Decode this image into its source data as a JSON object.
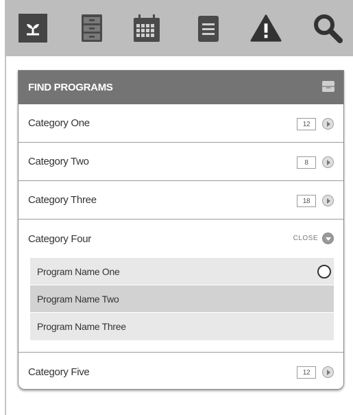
{
  "toolbar": {
    "icons": [
      "home-plant-icon",
      "file-cabinet-icon",
      "calendar-icon",
      "notepad-icon",
      "alert-icon",
      "search-icon"
    ],
    "active": "home-plant-icon"
  },
  "panel": {
    "title": "FIND PROGRAMS",
    "header_icon": "inbox-tray-icon"
  },
  "categories": [
    {
      "label": "Category One",
      "count": "12",
      "expanded": false
    },
    {
      "label": "Category Two",
      "count": "8",
      "expanded": false
    },
    {
      "label": "Category Three",
      "count": "18",
      "expanded": false
    },
    {
      "label": "Category Four",
      "expanded": true,
      "close_label": "CLOSE",
      "programs": [
        {
          "label": "Program Name One"
        },
        {
          "label": "Program Name Two"
        },
        {
          "label": "Program Name Three"
        }
      ]
    },
    {
      "label": "Category Five",
      "count": "12",
      "expanded": false
    }
  ],
  "colors": {
    "toolbar_bg": "#bdbdbd",
    "header_bg": "#747474",
    "icon_dark": "#4a4a4a"
  }
}
